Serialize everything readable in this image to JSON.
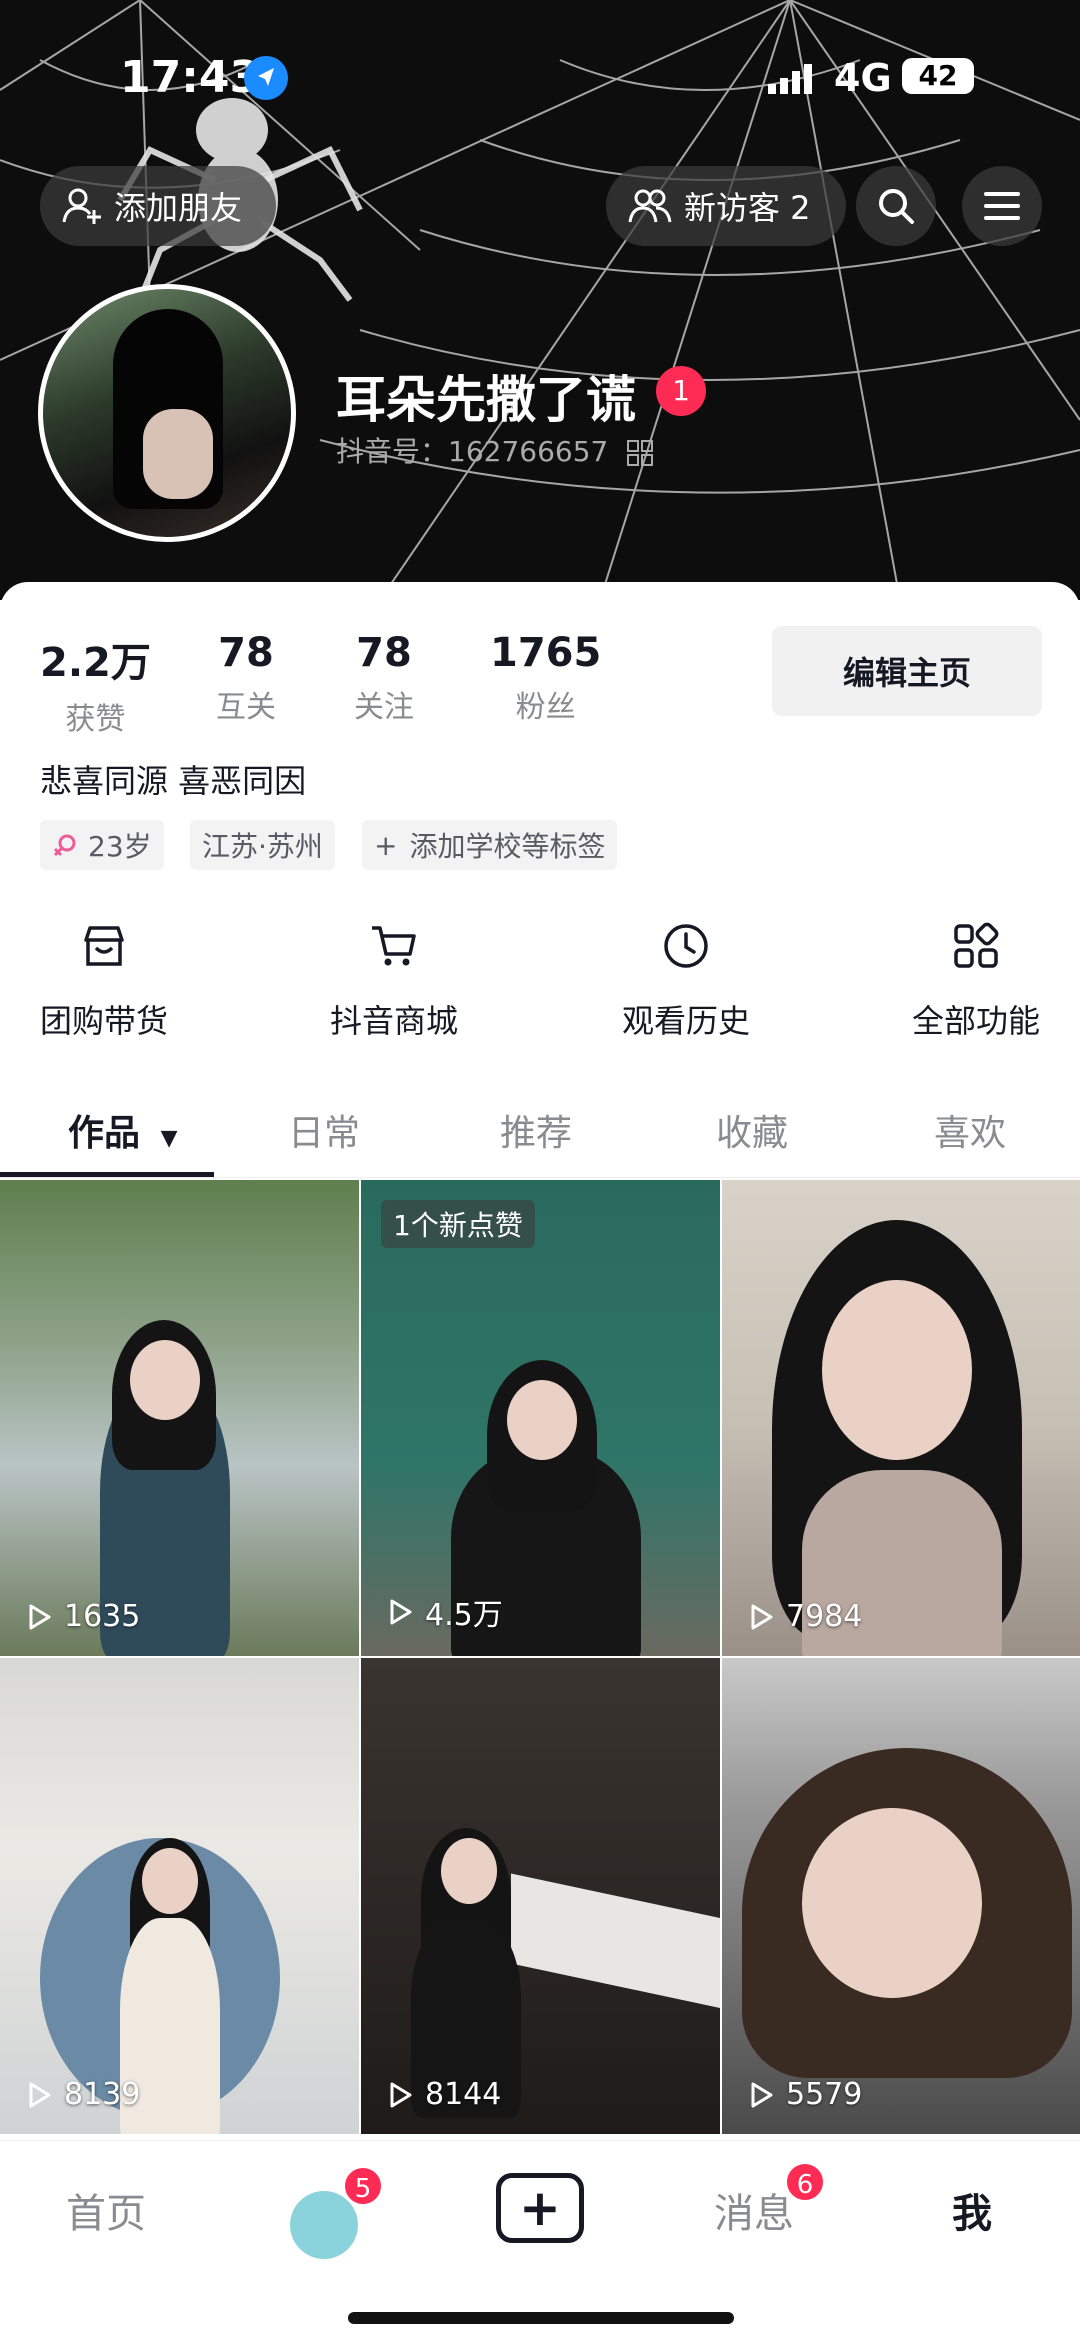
{
  "status_bar": {
    "time": "17:43",
    "network": "4G",
    "battery": "42"
  },
  "header": {
    "add_friend_label": "添加朋友",
    "visitor_label": "新访客 2",
    "nickname": "耳朵先撒了谎",
    "nickname_badge": "1",
    "douyin_id": "抖音号：162766657"
  },
  "stats": [
    {
      "value": "2.2万",
      "label": "获赞"
    },
    {
      "value": "78",
      "label": "互关"
    },
    {
      "value": "78",
      "label": "关注"
    },
    {
      "value": "1765",
      "label": "粉丝"
    }
  ],
  "edit_button": "编辑主页",
  "bio": "悲喜同源 喜恶同因",
  "tags": {
    "age": "23岁",
    "location": "江苏·苏州",
    "add_school": "添加学校等标签"
  },
  "functions": [
    {
      "label": "团购带货",
      "icon": "shop-icon"
    },
    {
      "label": "抖音商城",
      "icon": "cart-icon"
    },
    {
      "label": "观看历史",
      "icon": "clock-icon"
    },
    {
      "label": "全部功能",
      "icon": "grid-icon"
    }
  ],
  "tabs": [
    "作品",
    "日常",
    "推荐",
    "收藏",
    "喜欢"
  ],
  "videos": [
    {
      "plays": "1635"
    },
    {
      "plays": "4.5万",
      "badge": "1个新点赞"
    },
    {
      "plays": "7984"
    },
    {
      "plays": "8139"
    },
    {
      "plays": "8144"
    },
    {
      "plays": "5579"
    }
  ],
  "bottom_nav": {
    "home": "首页",
    "friends_badge": "5",
    "messages": "消息",
    "messages_badge": "6",
    "me": "我"
  },
  "colors": {
    "accent_red": "#fe2c55",
    "text_primary": "#161823",
    "text_secondary": "#8a8b91"
  }
}
